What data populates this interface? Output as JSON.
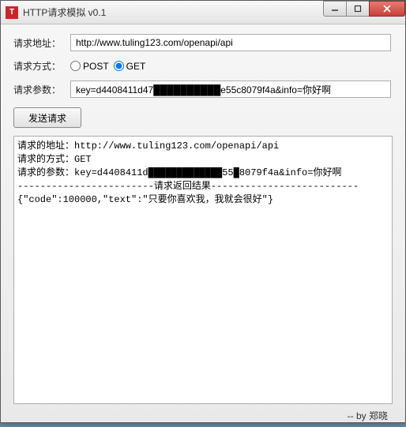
{
  "window": {
    "title": "HTTP请求模拟  v0.1",
    "icon_char": "T"
  },
  "form": {
    "url_label": "请求地址：",
    "url_value": "http://www.tuling123.com/openapi/api",
    "method_label": "请求方式：",
    "method_post": "POST",
    "method_get": "GET",
    "method_selected": "GET",
    "params_label": "请求参数：",
    "params_value": "key=d4408411d47██████████e55c8079f4a&info=你好啊",
    "send_label": "发送请求"
  },
  "output": {
    "line1": "请求的地址：http://www.tuling123.com/openapi/api",
    "line2": "请求的方式：GET",
    "line3": "请求的参数：key=d4408411d█████████████55█8079f4a&info=你好啊",
    "divider": "------------------------请求返回结果--------------------------",
    "response": "{\"code\":100000,\"text\":\"只要你喜欢我，我就会很好\"}"
  },
  "footer": {
    "credit": "-- by 郑晓"
  }
}
